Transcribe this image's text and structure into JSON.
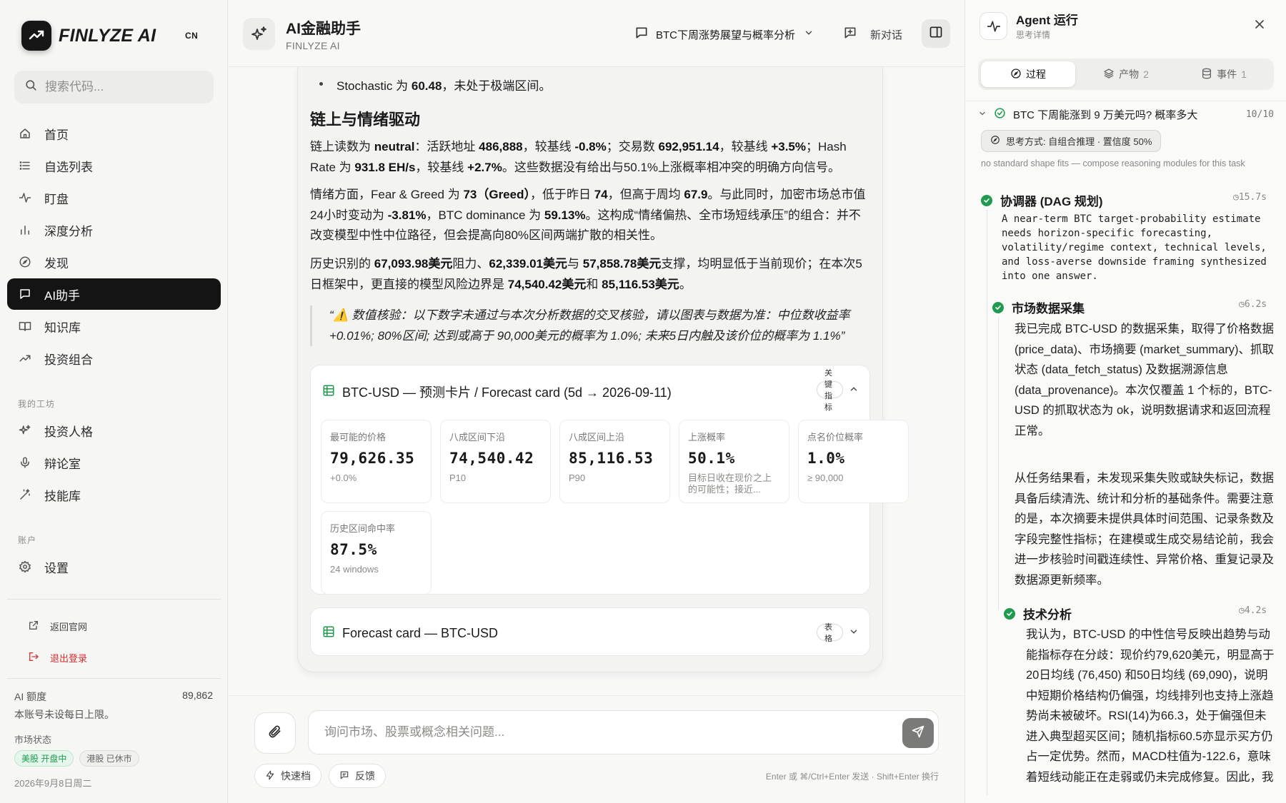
{
  "brand": {
    "name": "FINLYZE AI",
    "lang": "CN"
  },
  "search": {
    "placeholder": "搜索代码..."
  },
  "nav": {
    "items": [
      {
        "label": "首页",
        "icon": "home-icon"
      },
      {
        "label": "自选列表",
        "icon": "list-icon"
      },
      {
        "label": "盯盘",
        "icon": "pulse-icon"
      },
      {
        "label": "深度分析",
        "icon": "bar-chart-icon"
      },
      {
        "label": "发现",
        "icon": "compass-icon"
      },
      {
        "label": "AI助手",
        "icon": "chat-icon",
        "active": true
      },
      {
        "label": "知识库",
        "icon": "book-icon"
      },
      {
        "label": "投资组合",
        "icon": "trend-icon"
      }
    ],
    "workshop_title": "我的工坊",
    "workshop": [
      {
        "label": "投资人格",
        "icon": "sparkles-icon"
      },
      {
        "label": "辩论室",
        "icon": "mic-icon"
      },
      {
        "label": "技能库",
        "icon": "wand-icon"
      }
    ],
    "account_title": "账户",
    "account": [
      {
        "label": "设置",
        "icon": "gear-icon"
      }
    ],
    "back_to_site": "返回官网",
    "logout": "退出登录"
  },
  "quota": {
    "label": "AI 额度",
    "value": "89,862",
    "note": "本账号未设每日上限。"
  },
  "market": {
    "label": "市场状态",
    "us": "美股 开盘中",
    "hk": "港股 已休市",
    "date": "2026年9月8日周二"
  },
  "header": {
    "title": "AI金融助手",
    "subtitle": "FINLYZE AI",
    "conversation": "BTC下周涨势展望与概率分析",
    "new_chat": "新对话"
  },
  "message": {
    "bullet_prefix": "Stochastic 为 ",
    "bullet_value": "60.48",
    "bullet_suffix": "，未处于极端区间。",
    "heading": "链上与情绪驱动",
    "p1": {
      "a": "链上读数为 ",
      "b": "neutral",
      "c": "：活跃地址 ",
      "d": "486,888",
      "e": "，较基线 ",
      "f": "-0.8%",
      "g": "；交易数 ",
      "h": "692,951.14",
      "i": "，较基线 ",
      "j": "+3.5%",
      "k": "；Hash Rate 为 ",
      "l": "931.8 EH/s",
      "m": "，较基线 ",
      "n": "+2.7%",
      "o": "。这些数据没有给出与50.1%上涨概率相冲突的明确方向信号。"
    },
    "p2": {
      "a": "情绪方面，Fear & Greed 为 ",
      "b": "73（Greed）",
      "c": "，低于昨日 ",
      "d": "74",
      "e": "，但高于周均 ",
      "f": "67.9",
      "g": "。与此同时，加密市场总市值24小时变动为 ",
      "h": "-3.81%",
      "i": "，BTC dominance 为 ",
      "j": "59.13%",
      "k": "。这构成“情绪偏热、全市场短线承压”的组合：并不改变模型中性中位路径，但会提高向80%区间两端扩散的相关性。"
    },
    "p3": {
      "a": "历史识别的 ",
      "b": "67,093.98美元",
      "c": "阻力、",
      "d": "62,339.01美元",
      "e": "与 ",
      "f": "57,858.78美元",
      "g": "支撑，均明显低于当前现价；在本次5日框架中，更直接的模型风险边界是 ",
      "h": "74,540.42美元",
      "i": "和 ",
      "j": "85,116.53美元",
      "k": "。"
    },
    "quote": "“⚠️ 数值核验：以下数字未通过与本次分析数据的交叉核验，请以图表与数据为准：中位数收益率 +0.01%; 80%区间; 达到或高于 90,000美元的概率为 1.0%; 未来5日内触及该价位的概率为 1.1%”"
  },
  "forecast": {
    "title": "BTC-USD — 预测卡片 / Forecast card (5d → 2026-09-11)",
    "tag": "关键指标",
    "metrics": [
      {
        "label": "最可能的价格",
        "value": "79,626.35",
        "sub": "+0.0%"
      },
      {
        "label": "八成区间下沿",
        "value": "74,540.42",
        "sub": "P10"
      },
      {
        "label": "八成区间上沿",
        "value": "85,116.53",
        "sub": "P90"
      },
      {
        "label": "上涨概率",
        "value": "50.1%",
        "sub": "目标日收在现价之上的可能性；接近..."
      },
      {
        "label": "点名价位概率",
        "value": "1.0%",
        "sub": "≥ 90,000"
      },
      {
        "label": "历史区间命中率",
        "value": "87.5%",
        "sub": "24 windows"
      }
    ],
    "table_title": "Forecast card — BTC-USD",
    "table_tag": "表格"
  },
  "composer": {
    "placeholder": "询问市场、股票或概念相关问题...",
    "quick": "快速档",
    "feedback": "反馈",
    "hint": "Enter 或 ⌘/Ctrl+Enter 发送 · Shift+Enter 换行"
  },
  "agent": {
    "title": "Agent 运行",
    "subtitle": "思考详情",
    "tabs": [
      {
        "label": "过程",
        "count": ""
      },
      {
        "label": "产物",
        "count": "2"
      },
      {
        "label": "事件",
        "count": "1"
      }
    ],
    "task": "BTC 下周能涨到 9 万美元吗? 概率多大",
    "task_count": "10/10",
    "mode": "思考方式: 自组合推理 · 置信度 50%",
    "note": "no standard shape fits — compose reasoning modules for this task",
    "steps": [
      {
        "name": "协调器 (DAG 规划)",
        "duration": "15.7s",
        "body": "A near-term BTC target-probability estimate needs horizon-specific forecasting, volatility/regime context, technical levels, and loss-averse downside framing synthesized into one answer."
      },
      {
        "name": "市场数据采集",
        "duration": "6.2s",
        "body1": "我已完成 BTC-USD 的数据采集，取得了价格数据 (price_data)、市场摘要 (market_summary)、抓取状态 (data_fetch_status) 及数据溯源信息 (data_provenance)。本次仅覆盖 1 个标的，BTC-USD 的抓取状态为 ok，说明数据请求和返回流程正常。",
        "body2": "从任务结果看，未发现采集失败或缺失标记，数据具备后续清洗、统计和分析的基础条件。需要注意的是，本次摘要未提供具体时间范围、记录条数及字段完整性指标；在建模或生成交易结论前，我会进一步核验时间戳连续性、异常价格、重复记录及数据源更新频率。"
      },
      {
        "name": "技术分析",
        "duration": "4.2s",
        "body": "我认为，BTC-USD 的中性信号反映出趋势与动能指标存在分歧：现价约79,620美元，明显高于20日均线 (76,450) 和50日均线 (69,090)，说明中短期价格结构仍偏强，均线排列也支持上涨趋势尚未被破坏。RSI(14)为66.3，处于偏强但未进入典型超买区间；随机指标60.5亦显示买方仍占一定优势。然而，MACD柱值为-122.6，意味着短线动能正在走弱或仍未完成修复。因此，我"
      }
    ]
  }
}
